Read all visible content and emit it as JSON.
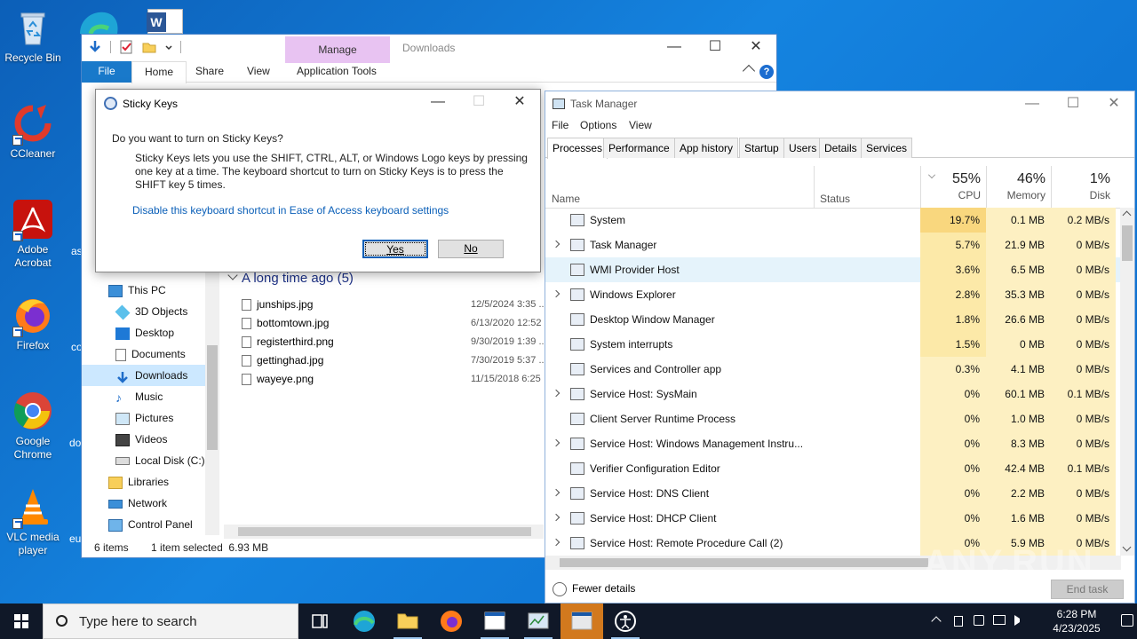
{
  "desktop": {
    "icons": [
      {
        "label": "Recycle Bin",
        "icon": "recycle-bin-icon"
      },
      {
        "label": "CCleaner",
        "icon": "ccleaner-icon"
      },
      {
        "label": "Adobe Acrobat",
        "icon": "adobe-acrobat-icon"
      },
      {
        "label": "Firefox",
        "icon": "firefox-icon"
      },
      {
        "label": "Google Chrome",
        "icon": "chrome-icon"
      },
      {
        "label": "VLC media player",
        "icon": "vlc-icon"
      }
    ],
    "partial_labels": [
      "as",
      "co",
      "do",
      "eu"
    ]
  },
  "explorer": {
    "window_title": "Downloads",
    "manage_tab": "Manage",
    "tabs": [
      "File",
      "Home",
      "Share",
      "View",
      "Application Tools"
    ],
    "nav": [
      {
        "label": "This PC",
        "icon": "this-pc-icon"
      },
      {
        "label": "3D Objects",
        "icon": "3d-objects-icon"
      },
      {
        "label": "Desktop",
        "icon": "desktop-folder-icon"
      },
      {
        "label": "Documents",
        "icon": "documents-icon"
      },
      {
        "label": "Downloads",
        "icon": "downloads-icon",
        "selected": true
      },
      {
        "label": "Music",
        "icon": "music-icon"
      },
      {
        "label": "Pictures",
        "icon": "pictures-icon"
      },
      {
        "label": "Videos",
        "icon": "videos-icon"
      },
      {
        "label": "Local Disk (C:)",
        "icon": "local-disk-icon"
      },
      {
        "label": "Libraries",
        "icon": "libraries-icon"
      },
      {
        "label": "Network",
        "icon": "network-icon"
      },
      {
        "label": "Control Panel",
        "icon": "control-panel-icon"
      }
    ],
    "group_header": "A long time ago (5)",
    "files": [
      {
        "name": "junships.jpg",
        "date": "12/5/2024 3:35 ..."
      },
      {
        "name": "bottomtown.jpg",
        "date": "6/13/2020 12:52"
      },
      {
        "name": "registerthird.png",
        "date": "9/30/2019 1:39 ..."
      },
      {
        "name": "gettinghad.jpg",
        "date": "7/30/2019 5:37 ..."
      },
      {
        "name": "wayeye.png",
        "date": "11/15/2018 6:25"
      }
    ],
    "status_items": "6 items",
    "status_selected": "1 item selected  6.93 MB"
  },
  "sticky_keys": {
    "title": "Sticky Keys",
    "question": "Do you want to turn on Sticky Keys?",
    "description": "Sticky Keys lets you use the SHIFT, CTRL, ALT, or Windows Logo keys by pressing one key at a time. The keyboard shortcut to turn on Sticky Keys is to press the SHIFT key 5 times.",
    "link": "Disable this keyboard shortcut in Ease of Access keyboard settings",
    "yes": "Yes",
    "no": "No"
  },
  "task_manager": {
    "title": "Task Manager",
    "menu": [
      "File",
      "Options",
      "View"
    ],
    "tabs": [
      "Processes",
      "Performance",
      "App history",
      "Startup",
      "Users",
      "Details",
      "Services"
    ],
    "columns": {
      "name": "Name",
      "status": "Status",
      "cpu_pct": "55%",
      "cpu": "CPU",
      "mem_pct": "46%",
      "mem": "Memory",
      "disk_pct": "1%",
      "disk": "Disk"
    },
    "processes": [
      {
        "name": "System",
        "cpu": "19.7%",
        "mem": "0.1 MB",
        "disk": "0.2 MB/s",
        "expandable": false
      },
      {
        "name": "Task Manager",
        "cpu": "5.7%",
        "mem": "21.9 MB",
        "disk": "0 MB/s",
        "expandable": true
      },
      {
        "name": "WMI Provider Host",
        "cpu": "3.6%",
        "mem": "6.5 MB",
        "disk": "0 MB/s",
        "expandable": false,
        "selected": true
      },
      {
        "name": "Windows Explorer",
        "cpu": "2.8%",
        "mem": "35.3 MB",
        "disk": "0 MB/s",
        "expandable": true
      },
      {
        "name": "Desktop Window Manager",
        "cpu": "1.8%",
        "mem": "26.6 MB",
        "disk": "0 MB/s",
        "expandable": false
      },
      {
        "name": "System interrupts",
        "cpu": "1.5%",
        "mem": "0 MB",
        "disk": "0 MB/s",
        "expandable": false
      },
      {
        "name": "Services and Controller app",
        "cpu": "0.3%",
        "mem": "4.1 MB",
        "disk": "0 MB/s",
        "expandable": false
      },
      {
        "name": "Service Host: SysMain",
        "cpu": "0%",
        "mem": "60.1 MB",
        "disk": "0.1 MB/s",
        "expandable": true
      },
      {
        "name": "Client Server Runtime Process",
        "cpu": "0%",
        "mem": "1.0 MB",
        "disk": "0 MB/s",
        "expandable": false
      },
      {
        "name": "Service Host: Windows Management Instru...",
        "cpu": "0%",
        "mem": "8.3 MB",
        "disk": "0 MB/s",
        "expandable": true
      },
      {
        "name": "Verifier Configuration Editor",
        "cpu": "0%",
        "mem": "42.4 MB",
        "disk": "0.1 MB/s",
        "expandable": false
      },
      {
        "name": "Service Host: DNS Client",
        "cpu": "0%",
        "mem": "2.2 MB",
        "disk": "0 MB/s",
        "expandable": true
      },
      {
        "name": "Service Host: DHCP Client",
        "cpu": "0%",
        "mem": "1.6 MB",
        "disk": "0 MB/s",
        "expandable": true
      },
      {
        "name": "Service Host: Remote Procedure Call (2)",
        "cpu": "0%",
        "mem": "5.9 MB",
        "disk": "0 MB/s",
        "expandable": true
      }
    ],
    "fewer_details": "Fewer details",
    "end_task": "End task"
  },
  "taskbar": {
    "search_placeholder": "Type here to search",
    "time": "6:28 PM",
    "date": "4/23/2025"
  },
  "watermark": "ANY.RUN",
  "colors": {
    "desktop": "#0a6cc7",
    "accent": "#1979ca",
    "manage_tab": "#e8c3f2",
    "cpu_hot": "#f9d77e",
    "cpu_warm": "#fdf0c2",
    "taskbar": "#101828"
  }
}
